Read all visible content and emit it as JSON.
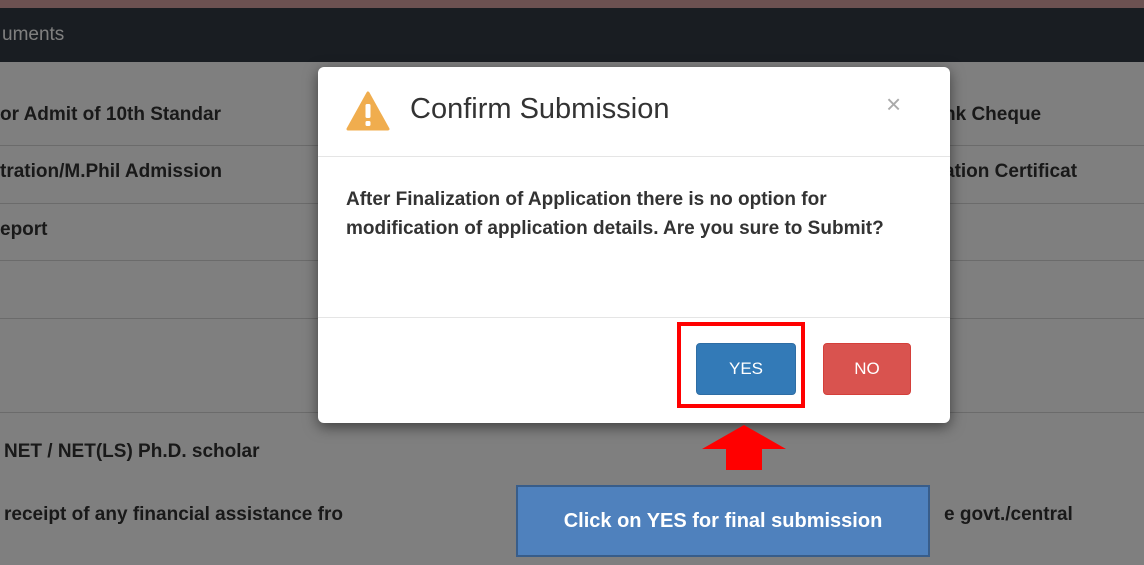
{
  "header": {
    "title": "uments"
  },
  "background_rows": {
    "left": [
      "or Admit of 10th Standar",
      "tration/M.Phil Admission",
      "eport",
      "NET / NET(LS) Ph.D. scholar",
      "receipt of any financial assistance fro"
    ],
    "right": [
      "nk Cheque",
      "ation Certificat",
      "e govt./central"
    ]
  },
  "modal": {
    "title": "Confirm Submission",
    "close": "×",
    "body": "After Finalization of Application there is no option for modification of application details. Are you sure to Submit?",
    "yes_label": "YES",
    "no_label": "NO"
  },
  "annotation": {
    "callout_text": "Click on YES for final submission"
  },
  "colors": {
    "header_bg": "#333a44",
    "yes_button": "#337ab7",
    "no_button": "#d9534f",
    "highlight": "#ff0000",
    "callout_bg": "#4f81bd",
    "warning": "#f0ad4e"
  },
  "icons": [
    "warning-icon",
    "close-icon",
    "arrow-up-icon"
  ]
}
